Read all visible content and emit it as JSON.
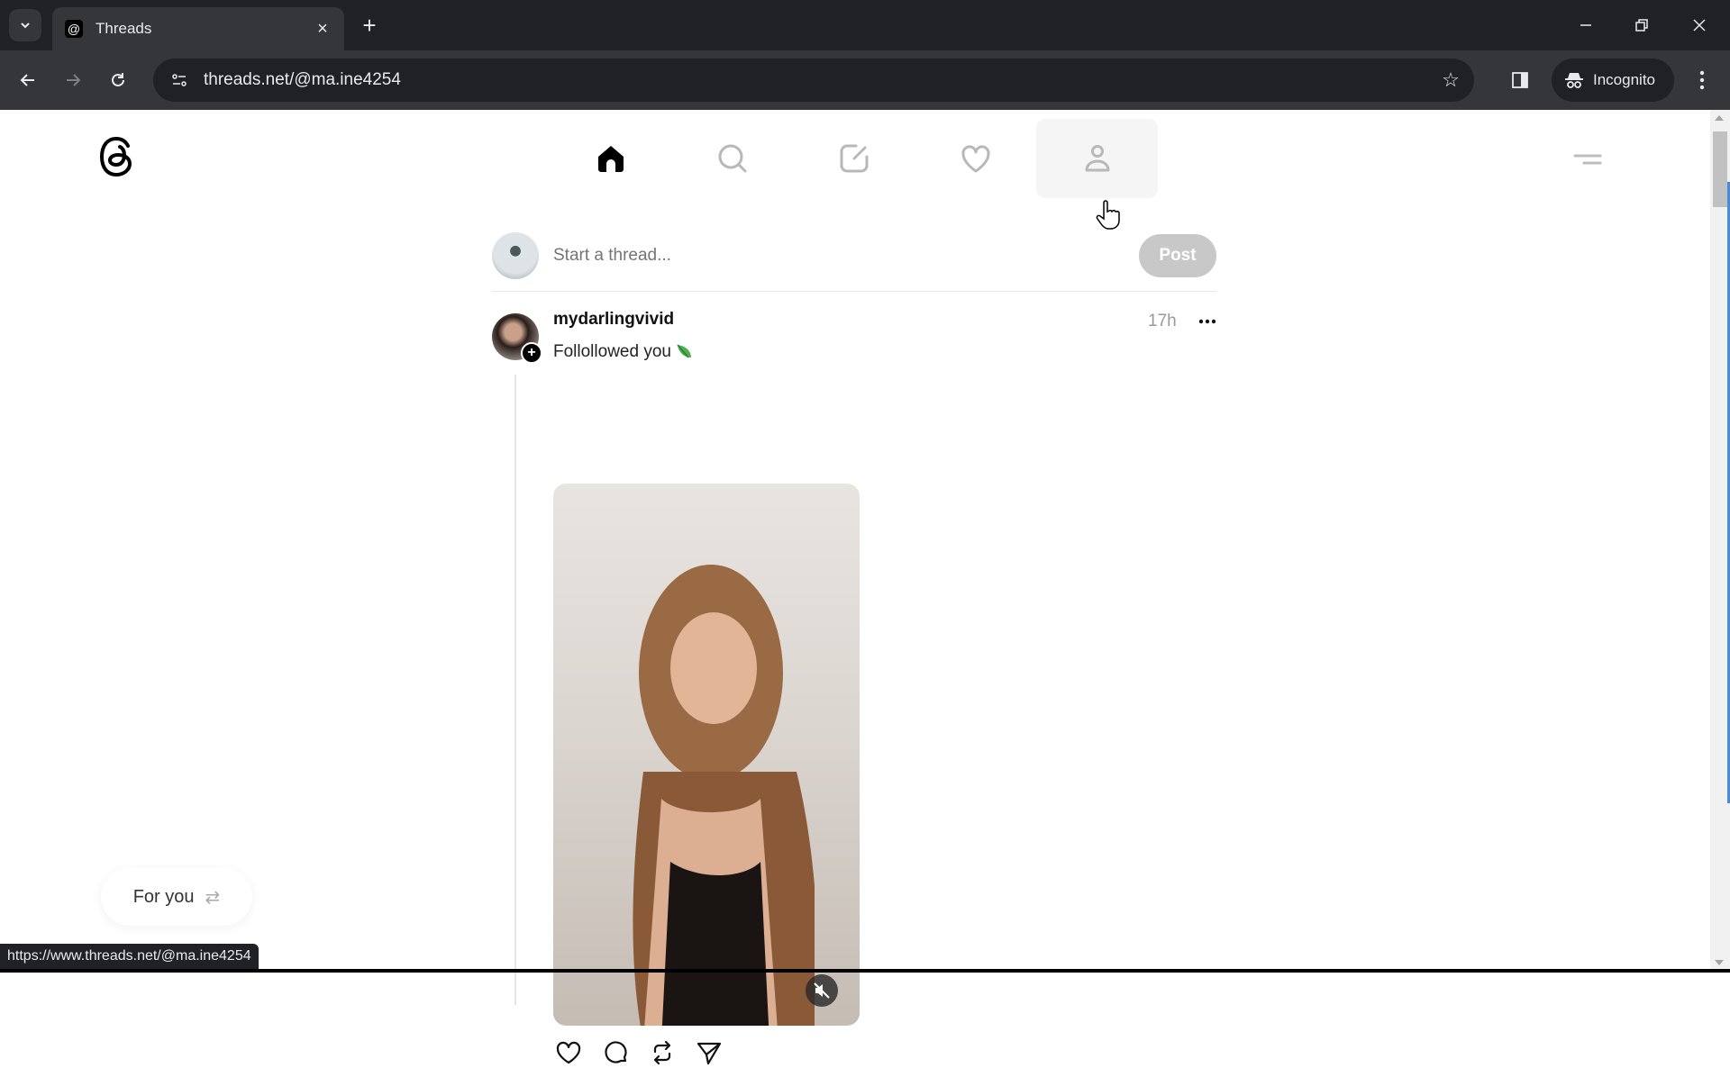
{
  "browser": {
    "tab": {
      "title": "Threads",
      "favicon": "threads-icon",
      "close_icon": "close-icon"
    },
    "new_tab_icon": "plus-icon",
    "tab_list_icon": "chevron-down-icon",
    "window_controls": {
      "minimize": "minimize-icon",
      "restore": "restore-icon",
      "close": "close-icon"
    },
    "nav": {
      "back": "arrow-left-icon",
      "forward": "arrow-right-icon",
      "reload": "reload-icon"
    },
    "url": "threads.net/@ma.ine4254",
    "bookmark_icon": "star-icon",
    "side_panel_icon": "side-panel-icon",
    "incognito_label": "Incognito",
    "menu_icon": "kebab-icon"
  },
  "app": {
    "logo": "threads-logo-icon",
    "nav": [
      {
        "name": "home",
        "icon": "home-icon",
        "active": true
      },
      {
        "name": "search",
        "icon": "search-icon",
        "active": false
      },
      {
        "name": "create",
        "icon": "compose-icon",
        "active": false
      },
      {
        "name": "activity",
        "icon": "heart-icon",
        "active": false
      },
      {
        "name": "profile",
        "icon": "person-icon",
        "active": false,
        "hovered": true
      }
    ],
    "menu_icon": "menu-icon"
  },
  "composer": {
    "placeholder": "Start a thread...",
    "value": "",
    "post_label": "Post"
  },
  "thread": {
    "username": "mydarlingvivid",
    "timestamp": "17h",
    "more_label": "···",
    "text": "Follollowed you",
    "emoji": "leaf-icon",
    "media": {
      "type": "video",
      "muted": true
    },
    "actions": [
      "like",
      "reply",
      "repost",
      "share"
    ]
  },
  "feed_switcher": {
    "label": "For you",
    "icon": "swap-icon"
  },
  "status_bar": {
    "url": "https://www.threads.net/@ma.ine4254"
  },
  "colors": {
    "chrome_dark": "#202124",
    "chrome_toolbar": "#35363a",
    "post_button_disabled": "#c8c8c8",
    "scroll_progress": "#4a8ad6"
  }
}
